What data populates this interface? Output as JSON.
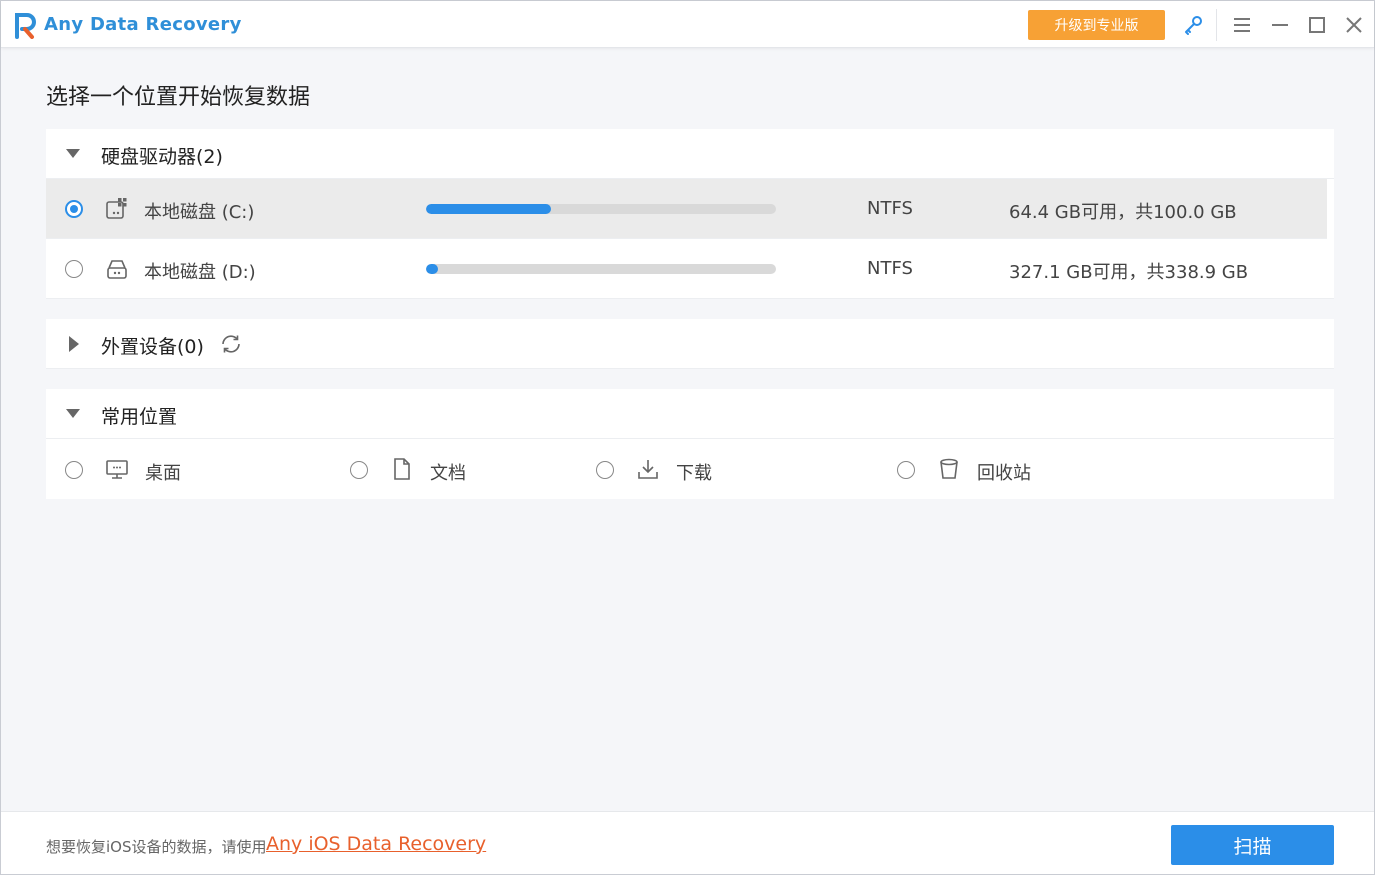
{
  "app": {
    "title": "Any Data Recovery",
    "upgrade_label": "升级到专业版",
    "accent": "#2b8ee8",
    "upgrade_color": "#f7a135"
  },
  "page_title": "选择一个位置开始恢复数据",
  "hard_drives": {
    "title": "硬盘驱动器(2)",
    "drives": [
      {
        "name": "本地磁盘 (C:)",
        "fs": "NTFS",
        "space": "64.4 GB可用，共100.0 GB",
        "used_fraction": 0.356,
        "selected": true,
        "icon": "windows-drive-icon"
      },
      {
        "name": "本地磁盘 (D:)",
        "fs": "NTFS",
        "space": "327.1 GB可用，共338.9 GB",
        "used_fraction": 0.035,
        "selected": false,
        "icon": "hard-drive-icon"
      }
    ]
  },
  "external": {
    "title": "外置设备(0)"
  },
  "common": {
    "title": "常用位置",
    "items": [
      {
        "label": "桌面",
        "icon": "desktop-icon"
      },
      {
        "label": "文档",
        "icon": "document-icon"
      },
      {
        "label": "下载",
        "icon": "download-icon"
      },
      {
        "label": "回收站",
        "icon": "recycle-bin-icon"
      }
    ]
  },
  "footer": {
    "text": "想要恢复iOS设备的数据，请使用",
    "link": "Any iOS Data Recovery",
    "scan_label": "扫描"
  }
}
